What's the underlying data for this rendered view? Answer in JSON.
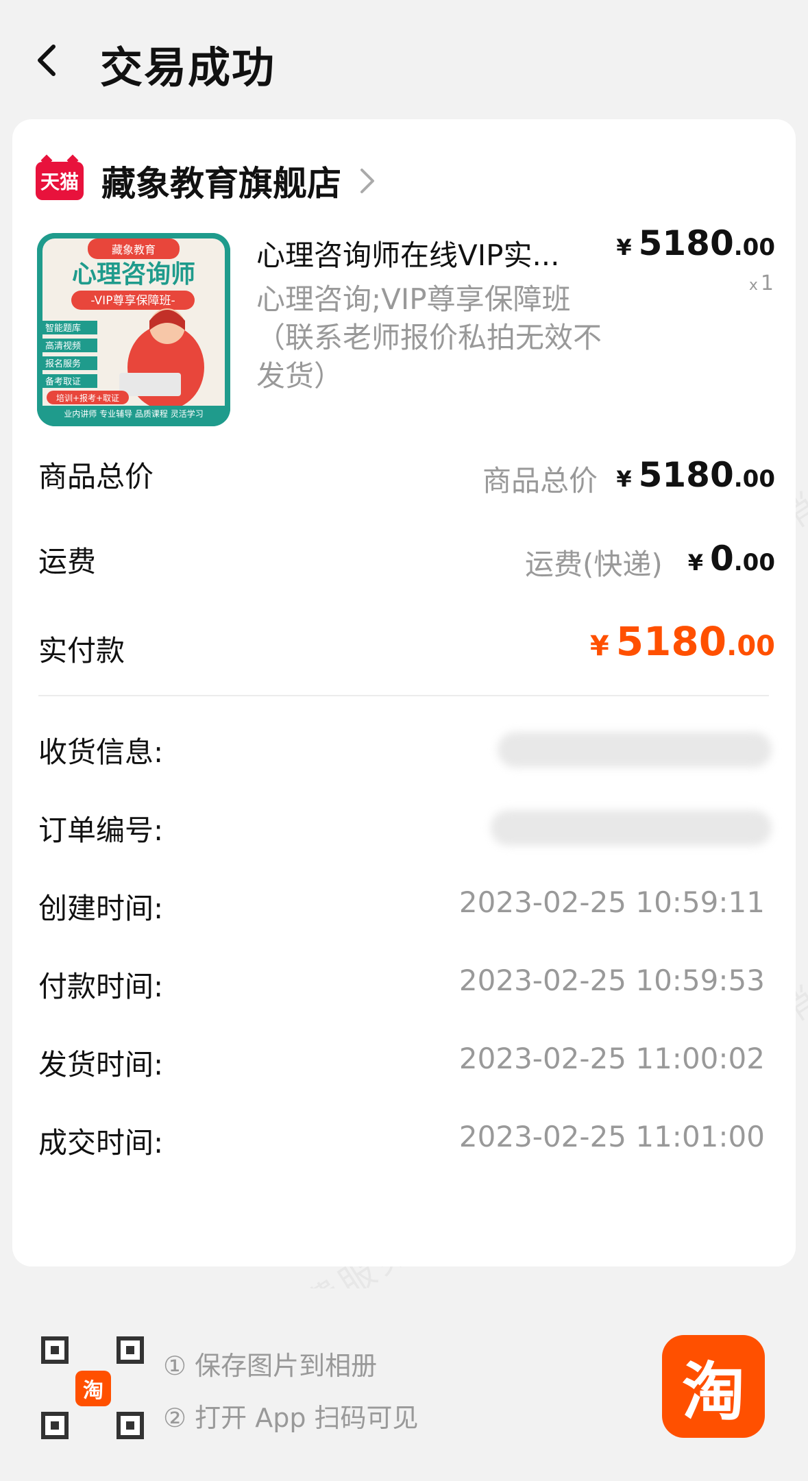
{
  "header": {
    "title": "交易成功"
  },
  "store": {
    "badge": "天猫",
    "name": "藏象教育旗舰店"
  },
  "product": {
    "image_text": {
      "brand": "藏象教育",
      "title": "心理咨询师",
      "subtitle": "-VIP尊享保障班-",
      "features": [
        "智能题库",
        "高清视频",
        "报名服务",
        "备考取证"
      ],
      "tag": "培训+报考+取证",
      "bottom": "业内讲师 专业辅导 品质课程 灵活学习"
    },
    "title": "心理咨询师在线VIP实...",
    "spec": "心理咨询;VIP尊享保障班（联系老师报价私拍无效不发货）",
    "price_symbol": "¥",
    "price_int": "5180",
    "price_dec": ".00",
    "qty_prefix": "x",
    "qty": "1"
  },
  "summary": {
    "goods_total_label": "商品总价",
    "goods_total_sublabel": "商品总价",
    "goods_total_int": "5180",
    "goods_total_dec": ".00",
    "shipping_label": "运费",
    "shipping_sublabel": "运费(快递)",
    "shipping_int": "0",
    "shipping_dec": ".00",
    "paid_label": "实付款",
    "paid_int": "5180",
    "paid_dec": ".00",
    "currency": "¥"
  },
  "info": {
    "shipping_info_label": "收货信息:",
    "order_no_label": "订单编号:",
    "created_label": "创建时间:",
    "created_value": "2023-02-25 10:59:11",
    "paid_time_label": "付款时间:",
    "paid_time_value": "2023-02-25 10:59:53",
    "shipped_label": "发货时间:",
    "shipped_value": "2023-02-25 11:00:02",
    "completed_label": "成交时间:",
    "completed_value": "2023-02-25 11:01:00"
  },
  "footer": {
    "qr_logo": "淘",
    "step1": "① 保存图片到相册",
    "step2": "② 打开 App 扫码可见",
    "app_icon": "淘"
  },
  "watermark": {
    "text": "消费保 您身边的消费服务管家"
  },
  "colors": {
    "accent": "#ff5000",
    "tmall_red": "#e8123c",
    "muted": "#999999"
  }
}
